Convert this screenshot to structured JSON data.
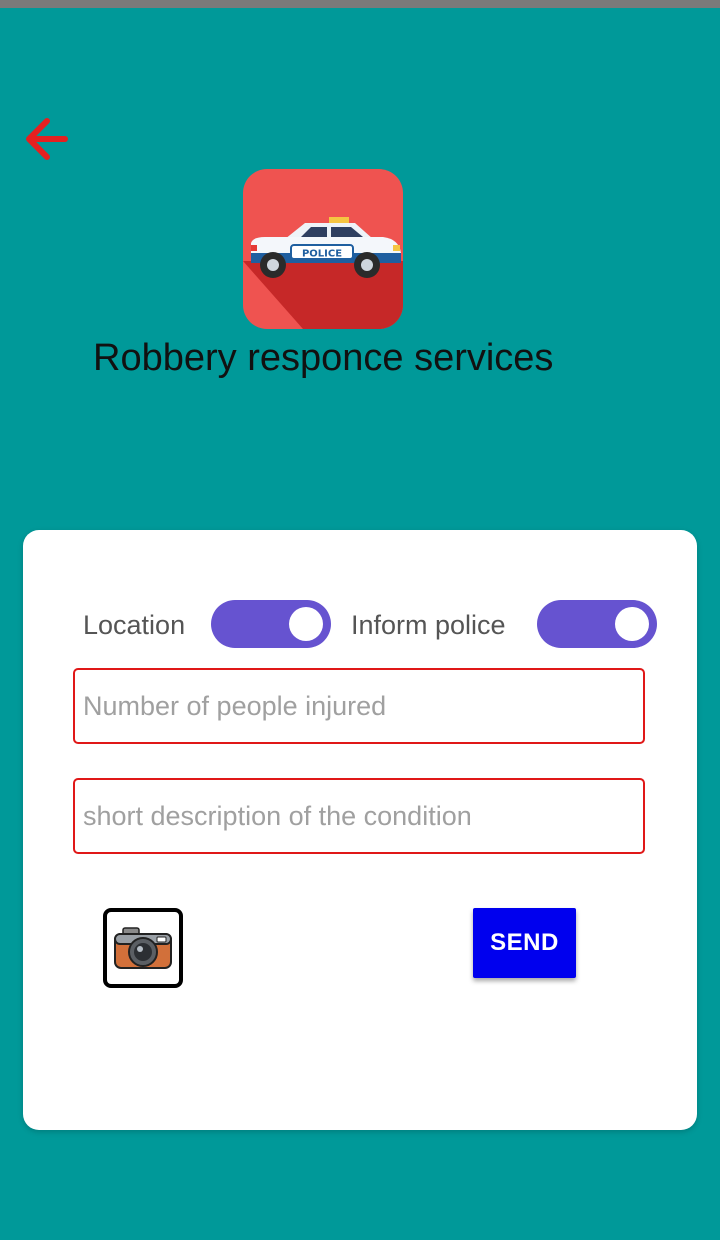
{
  "header": {
    "back_icon": "arrow-left-icon",
    "logo_icon": "police-car-icon",
    "logo_text": "POLICE",
    "title": "Robbery responce services"
  },
  "form": {
    "toggles": [
      {
        "label": "Location",
        "state": "on"
      },
      {
        "label": "Inform police",
        "state": "on"
      }
    ],
    "injured": {
      "placeholder": "Number of people injured",
      "value": ""
    },
    "description": {
      "placeholder": "short description of the condition",
      "value": ""
    },
    "camera_icon": "camera-icon",
    "send_label": "SEND"
  },
  "colors": {
    "background": "#009999",
    "card": "#ffffff",
    "toggle_on": "#6653d0",
    "field_border": "#e01818",
    "send_button": "#0000ee",
    "back_arrow": "#e52020",
    "logo_bg": "#ef5350"
  }
}
